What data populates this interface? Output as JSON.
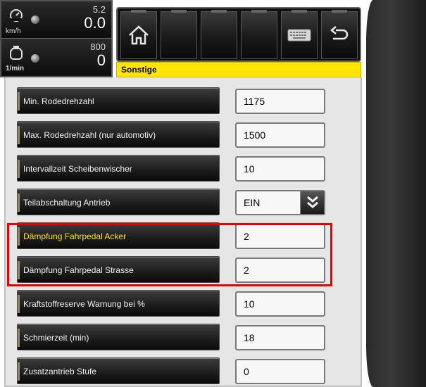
{
  "gauges": {
    "speed": {
      "value_small": "5.2",
      "value_big": "0.0",
      "unit": "km/h"
    },
    "rpm": {
      "value_small": "800",
      "value_big": "0",
      "unit": "1/min"
    }
  },
  "toolbar": {
    "buttons": [
      "home-icon",
      "empty",
      "empty",
      "empty",
      "keyboard-icon",
      "back-icon"
    ]
  },
  "section": {
    "title": "Sonstige"
  },
  "settings": [
    {
      "label": "Min. Rodedrehzahl",
      "value": "1175"
    },
    {
      "label": "Max. Rodedrehzahl (nur automotiv)",
      "value": "1500"
    },
    {
      "label": "Intervallzeit Scheibenwischer",
      "value": "10"
    },
    {
      "label": "Teilabschaltung Antrieb",
      "value": "EIN"
    },
    {
      "label": "Dämpfung Fahrpedal Acker",
      "value": "2"
    },
    {
      "label": "Dämpfung Fahrpedal Strasse",
      "value": "2"
    },
    {
      "label": "Kraftstoffreserve Warnung bei %",
      "value": "10"
    },
    {
      "label": "Schmierzeit (min)",
      "value": "18"
    },
    {
      "label": "Zusatzantrieb Stufe",
      "value": "0"
    }
  ],
  "colors": {
    "accent_yellow": "#ffe500",
    "highlight_red": "#e60000"
  }
}
